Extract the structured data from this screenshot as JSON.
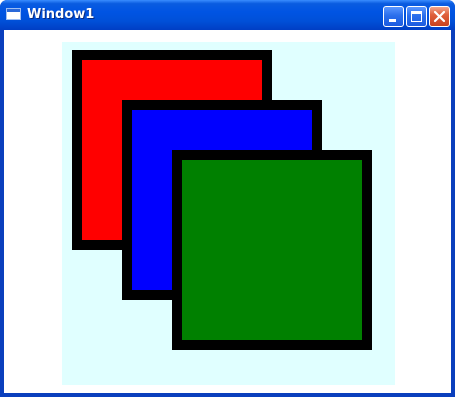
{
  "window": {
    "title": "Window1",
    "icon": "window-app-icon",
    "caption_buttons": [
      "minimize-icon",
      "maximize-icon",
      "close-icon"
    ]
  },
  "canvas": {
    "background": "#e0ffff",
    "squares": [
      {
        "name": "red-square",
        "fill": "#ff0000",
        "stroke": "#000000"
      },
      {
        "name": "blue-square",
        "fill": "#0000ff",
        "stroke": "#000000"
      },
      {
        "name": "green-square",
        "fill": "#008000",
        "stroke": "#000000"
      }
    ]
  }
}
